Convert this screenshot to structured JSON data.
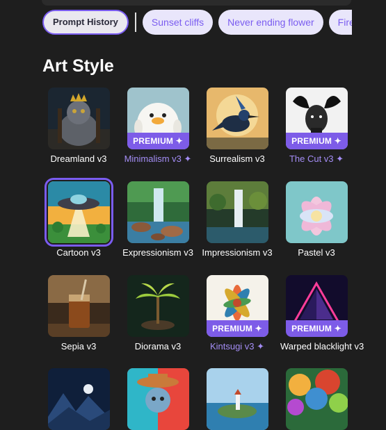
{
  "chips": {
    "active": "Prompt History",
    "items": [
      "Sunset cliffs",
      "Never ending flower",
      "Fire and w"
    ]
  },
  "section": {
    "title": "Art Style"
  },
  "badge_label": "PREMIUM ✦",
  "styles": [
    {
      "label": "Dreamland v3",
      "premium": false,
      "icon": "crowned-cat-image"
    },
    {
      "label": "Minimalism v3 ✦",
      "premium": true,
      "icon": "duck-image"
    },
    {
      "label": "Surrealism v3",
      "premium": false,
      "icon": "blue-bird-image"
    },
    {
      "label": "The Cut v3 ✦",
      "premium": true,
      "icon": "moose-engraving-image"
    },
    {
      "label": "Cartoon v3",
      "premium": false,
      "selected": true,
      "icon": "ufo-landscape-image"
    },
    {
      "label": "Expressionism v3",
      "premium": false,
      "icon": "waterfall-forest-image"
    },
    {
      "label": "Impressionism v3",
      "premium": false,
      "icon": "painted-waterfall-image"
    },
    {
      "label": "Pastel v3",
      "premium": false,
      "icon": "lotus-flower-image"
    },
    {
      "label": "Sepia v3",
      "premium": false,
      "icon": "iced-drink-image"
    },
    {
      "label": "Diorama v3",
      "premium": false,
      "icon": "palm-diorama-image"
    },
    {
      "label": "Kintsugi v3 ✦",
      "premium": true,
      "icon": "ornate-flower-image"
    },
    {
      "label": "Warped blacklight v3",
      "premium": true,
      "icon": "neon-pyramid-image"
    },
    {
      "label": "",
      "premium": false,
      "icon": "night-mountains-image"
    },
    {
      "label": "",
      "premium": false,
      "icon": "cowboy-bear-image"
    },
    {
      "label": "",
      "premium": false,
      "icon": "coastal-lighthouse-image"
    },
    {
      "label": "",
      "premium": false,
      "icon": "rainbow-forest-image"
    }
  ]
}
